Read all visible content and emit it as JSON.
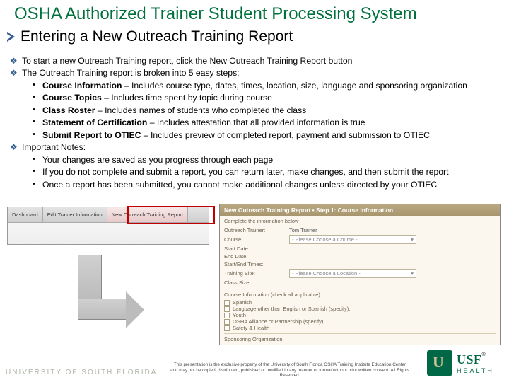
{
  "title": "OSHA Authorized Trainer Student Processing System",
  "subtitle": "Entering a New Outreach Training Report",
  "bullets": {
    "b1": "To start a new Outreach Training report, click the New Outreach Training Report button",
    "b2": "The Outreach Training report is broken into 5 easy steps:",
    "steps": [
      {
        "bold": "Course Information",
        "rest": " – Includes course type, dates, times, location, size, language and sponsoring organization"
      },
      {
        "bold": "Course Topics",
        "rest": " – Includes time spent by topic during course"
      },
      {
        "bold": "Class Roster",
        "rest": " – Includes names of students who completed the class"
      },
      {
        "bold": "Statement of Certification",
        "rest": " – Includes attestation that all provided information is true"
      },
      {
        "bold": "Submit Report to OTIEC",
        "rest": " – Includes preview of completed report, payment and submission to OTIEC"
      }
    ],
    "b3": "Important Notes:",
    "notes": [
      "Your changes are saved as you progress through each page",
      "If you do not complete and submit a report, you can return later, make changes, and then submit the report",
      "Once  a report has been submitted, you cannot make additional changes unless directed by your OTIEC"
    ]
  },
  "tabs": [
    "Dashboard",
    "Edit Trainer Information",
    "New Outreach Training Report"
  ],
  "formHeader": "New Outreach Training Report • Step 1: Course Information",
  "formDesc": "Complete the information below",
  "form": {
    "trainerLbl": "Outreach Trainer:",
    "trainerVal": "Tom Trainer",
    "courseLbl": "Course:",
    "coursePh": "- Please Choose a Course -",
    "startLbl": "Start Date:",
    "endLbl": "End Date:",
    "sfLbl": "Start/End Times:",
    "siteLbl": "Training Site:",
    "sitePh": "- Please Choose a Location -",
    "sizeLbl": "Class Size:"
  },
  "ciHeading": "Course Information  (check all applicable)",
  "checks": [
    "Spanish",
    "Language other than English or Spanish (specify):",
    "Youth",
    "OSHA Alliance or Partnership (specify):",
    "Safety & Health"
  ],
  "soHeading": "Sponsoring Organization",
  "uni": "UNIVERSITY OF SOUTH FLORIDA",
  "disclaimer": "This presentation is the exclusive property of the University of South Florida OSHA Training Institute Education Center and may not be copied, distributed, published or modified in any manner or format without prior written consent.  All Rights Reserved.",
  "logo": {
    "usf": "USF",
    "health": "HEALTH",
    "reg": "®"
  }
}
